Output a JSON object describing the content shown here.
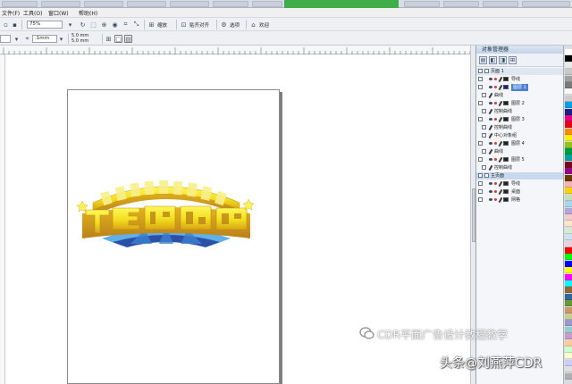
{
  "menubar": {
    "items": [
      "文件(F)",
      "工具(O)",
      "窗口(W)",
      "帮助(H)"
    ]
  },
  "toolbar1": {
    "zoom_value": "75%",
    "buttons": [
      "缩放",
      "贴齐对齐",
      "选项",
      "欢迎"
    ]
  },
  "toolbar2": {
    "outline_value": ".1mm",
    "nudge_x": "5.0 mm",
    "nudge_y": "5.0 mm"
  },
  "panel": {
    "title": "对象管理器",
    "layers": [
      {
        "name": "页面 1",
        "kind": "page"
      },
      {
        "name": "导线",
        "kind": "layer"
      },
      {
        "name": "图层 1",
        "kind": "layer",
        "selected": true
      },
      {
        "name": "曲线",
        "kind": "object"
      },
      {
        "name": "图层 2",
        "kind": "layer"
      },
      {
        "name": "控制曲线",
        "kind": "object"
      },
      {
        "name": "图层 3",
        "kind": "layer"
      },
      {
        "name": "控制曲线",
        "kind": "object"
      },
      {
        "name": "中心对象组",
        "kind": "object"
      },
      {
        "name": "图层 4",
        "kind": "layer"
      },
      {
        "name": "曲线",
        "kind": "object"
      },
      {
        "name": "图层 5",
        "kind": "layer"
      },
      {
        "name": "控制曲线",
        "kind": "object"
      },
      {
        "name": "主页面",
        "kind": "master"
      },
      {
        "name": "导线",
        "kind": "layer"
      },
      {
        "name": "桌面",
        "kind": "layer"
      },
      {
        "name": "网格",
        "kind": "layer"
      }
    ]
  },
  "palette": {
    "colors": [
      "#ffffff",
      "#000000",
      "#e9e9e9",
      "#c8c8c8",
      "#a0a0a0",
      "#7a7a7a",
      "#f7f7f7",
      "#cccccc",
      "#00a0e9",
      "#1d2088",
      "#e4007f",
      "#e60012",
      "#ff8c00",
      "#fff100",
      "#8fc31f",
      "#009944",
      "#00a29a",
      "#7d0022",
      "#920783",
      "#6a3906",
      "#f5b2b2",
      "#fdd000",
      "#c5e0b3",
      "#a6d5f2",
      "#b4a7d6",
      "#f4cccc",
      "#fce5cd",
      "#d9ead3",
      "#cfe2f3",
      "#ead1dc",
      "#ff0000",
      "#00ff00",
      "#0000ff",
      "#ffff00",
      "#ff00ff",
      "#00ffff",
      "#996633",
      "#336699",
      "#669933",
      "#cc9966",
      "#cccc99",
      "#9999cc",
      "#99cccc",
      "#cc99cc",
      "#ffcc99",
      "#ccffcc",
      "#ffffcc",
      "#ccccff",
      "#e0e0e0",
      "#b0b0b0"
    ]
  },
  "watermark": {
    "line1": "CDR平面广告设计教程教学",
    "line2": "头条@刘燕萍CDR"
  }
}
